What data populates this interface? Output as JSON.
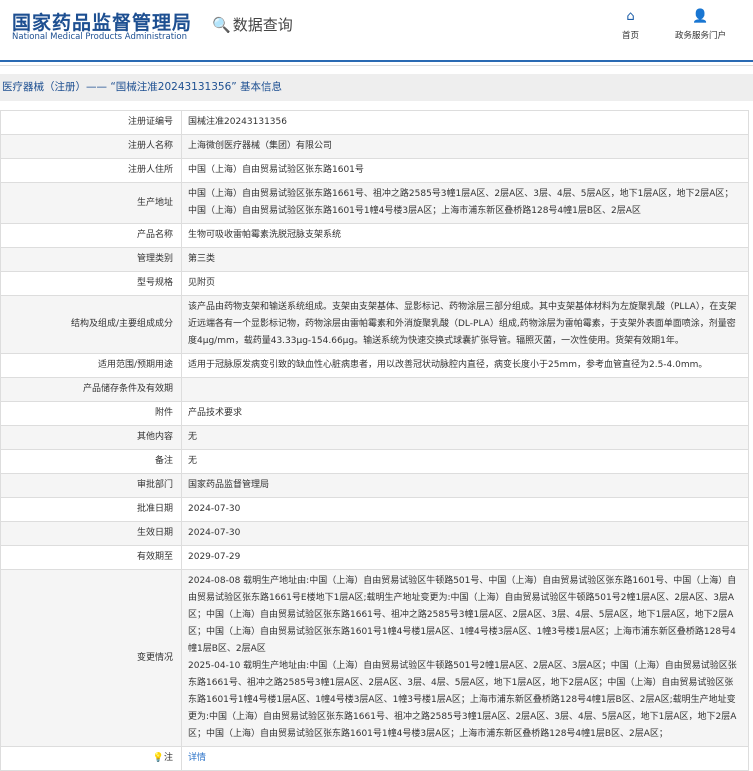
{
  "header": {
    "logo_cn": "国家药品监督管理局",
    "logo_en": "National Medical Products Administration",
    "query": "数据查询",
    "nav": [
      {
        "label": "首页",
        "icon": "home-icon"
      },
      {
        "label": "政务服务门户",
        "icon": "user-icon"
      }
    ]
  },
  "breadcrumb": "医疗器械（注册）—— “国械注准20243131356” 基本信息",
  "rows": [
    {
      "label": "注册证编号",
      "value": "国械注准20243131356"
    },
    {
      "label": "注册人名称",
      "value": "上海微创医疗器械（集团）有限公司"
    },
    {
      "label": "注册人住所",
      "value": "中国（上海）自由贸易试验区张东路1601号"
    },
    {
      "label": "生产地址",
      "value": "中国（上海）自由贸易试验区张东路1661号、祖冲之路2585号3幢1层A区、2层A区、3层、4层、5层A区，地下1层A区，地下2层A区；中国（上海）自由贸易试验区张东路1601号1幢4号楼3层A区；上海市浦东新区叠桥路128号4幢1层B区、2层A区"
    },
    {
      "label": "产品名称",
      "value": "生物可吸收雷帕霉素洗脱冠脉支架系统"
    },
    {
      "label": "管理类别",
      "value": "第三类"
    },
    {
      "label": "型号规格",
      "value": "见附页"
    },
    {
      "label": "结构及组成/主要组成成分",
      "value": "该产品由药物支架和输送系统组成。支架由支架基体、显影标记、药物涂层三部分组成。其中支架基体材料为左旋聚乳酸（PLLA），在支架近远端各有一个显影标记物，药物涂层由雷帕霉素和外消旋聚乳酸（DL-PLA）组成,药物涂层为雷帕霉素，于支架外表面单面喷涂，剂量密度4μg/mm，载药量43.33μg-154.66μg。输送系统为快速交换式球囊扩张导管。辐照灭菌，一次性使用。货架有效期1年。"
    },
    {
      "label": "适用范围/预期用途",
      "value": "适用于冠脉原发病变引致的缺血性心脏病患者，用以改善冠状动脉腔内直径，病变长度小于25mm，参考血管直径为2.5-4.0mm。"
    },
    {
      "label": "产品储存条件及有效期",
      "value": ""
    },
    {
      "label": "附件",
      "value": "产品技术要求"
    },
    {
      "label": "其他内容",
      "value": "无"
    },
    {
      "label": "备注",
      "value": "无"
    },
    {
      "label": "审批部门",
      "value": "国家药品监督管理局"
    },
    {
      "label": "批准日期",
      "value": "2024-07-30"
    },
    {
      "label": "生效日期",
      "value": "2024-07-30"
    },
    {
      "label": "有效期至",
      "value": "2029-07-29"
    },
    {
      "label": "变更情况",
      "value": "2024-08-08 载明生产地址由:中国（上海）自由贸易试验区牛顿路501号、中国（上海）自由贸易试验区张东路1601号、中国（上海）自由贸易试验区张东路1661号E楼地下1层A区;载明生产地址变更为:中国（上海）自由贸易试验区牛顿路501号2幢1层A区、2层A区、3层A区；中国（上海）自由贸易试验区张东路1661号、祖冲之路2585号3幢1层A区、2层A区、3层、4层、5层A区，地下1层A区，地下2层A区；中国（上海）自由贸易试验区张东路1601号1幢4号楼1层A区、1幢4号楼3层A区、1幢3号楼1层A区；上海市浦东新区叠桥路128号4幢1层B区、2层A区",
      "value2": "2025-04-10 载明生产地址由:中国（上海）自由贸易试验区牛顿路501号2幢1层A区、2层A区、3层A区；中国（上海）自由贸易试验区张东路1661号、祖冲之路2585号3幢1层A区、2层A区、3层、4层、5层A区，地下1层A区，地下2层A区；中国（上海）自由贸易试验区张东路1601号1幢4号楼1层A区、1幢4号楼3层A区、1幢3号楼1层A区；上海市浦东新区叠桥路128号4幢1层B区、2层A区;载明生产地址变更为:中国（上海）自由贸易试验区张东路1661号、祖冲之路2585号3幢1层A区、2层A区、3层、4层、5层A区，地下1层A区，地下2层A区；中国（上海）自由贸易试验区张东路1601号1幢4号楼3层A区；上海市浦东新区叠桥路128号4幢1层B区、2层A区；"
    },
    {
      "label": "注",
      "value": "详情"
    }
  ]
}
